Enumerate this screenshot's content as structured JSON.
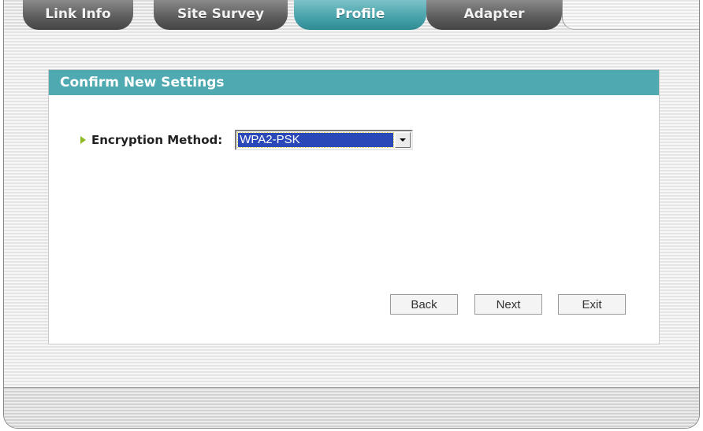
{
  "tabs": [
    {
      "label": "Link Info",
      "active": false
    },
    {
      "label": "Site Survey",
      "active": false
    },
    {
      "label": "Profile",
      "active": true
    },
    {
      "label": "Adapter",
      "active": false
    }
  ],
  "panel": {
    "title": "Confirm New Settings",
    "encryption": {
      "label": "Encryption Method:",
      "value": "WPA2-PSK"
    }
  },
  "buttons": {
    "back": "Back",
    "next": "Next",
    "exit": "Exit"
  },
  "colors": {
    "active_tab": "#45a1aa",
    "header": "#4fa9b1",
    "selection": "#2b48b9",
    "bullet": "#8dbb27"
  },
  "icons": {
    "bullet": "bullet-arrow-icon",
    "dropdown": "chevron-down-icon"
  }
}
